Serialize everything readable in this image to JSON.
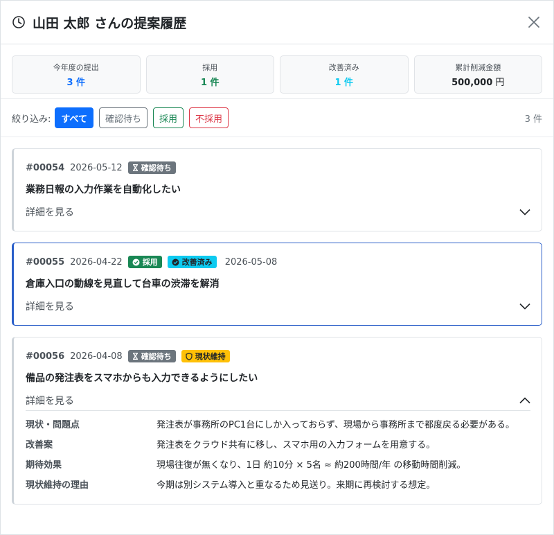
{
  "header": {
    "title": "山田 太郎 さんの提案履歴"
  },
  "stats": [
    {
      "label": "今年度の提出",
      "value": "3 件",
      "color": "#0d6efd"
    },
    {
      "label": "採用",
      "value": "1 件",
      "color": "#198754"
    },
    {
      "label": "改善済み",
      "value": "1 件",
      "color": "#0dcaf0"
    },
    {
      "label": "累計削減金額",
      "value": "500,000",
      "unit": " 円",
      "color": "#212529"
    }
  ],
  "filter": {
    "label": "絞り込み:",
    "buttons": {
      "all": "すべて",
      "pending": "確認待ち",
      "adopted": "採用",
      "rejected": "不採用"
    },
    "count": "3 件"
  },
  "cards": [
    {
      "id": "#00054",
      "date": "2026-05-12",
      "status": "確認待ち",
      "title": "業務日報の入力作業を自動化したい",
      "toggle": "詳細を見る"
    },
    {
      "id": "#00055",
      "date": "2026-04-22",
      "status": "採用",
      "status2": "改善済み",
      "date2": "2026-05-08",
      "title": "倉庫入口の動線を見直して台車の渋滞を解消",
      "toggle": "詳細を見る"
    },
    {
      "id": "#00056",
      "date": "2026-04-08",
      "status": "確認待ち",
      "status2": "現状維持",
      "title": "備品の発注表をスマホからも入力できるようにしたい",
      "toggle": "詳細を見る",
      "details": [
        {
          "key": "現状・問題点",
          "value": "発注表が事務所のPC1台にしか入っておらず、現場から事務所まで都度戻る必要がある。"
        },
        {
          "key": "改善案",
          "value": "発注表をクラウド共有に移し、スマホ用の入力フォームを用意する。"
        },
        {
          "key": "期待効果",
          "value": "現場往復が無くなり、1日 約10分 × 5名 ≈ 約200時間/年 の移動時間削減。"
        },
        {
          "key": "現状維持の理由",
          "value": "今期は別システム導入と重なるため見送り。来期に再検討する想定。"
        }
      ]
    }
  ]
}
